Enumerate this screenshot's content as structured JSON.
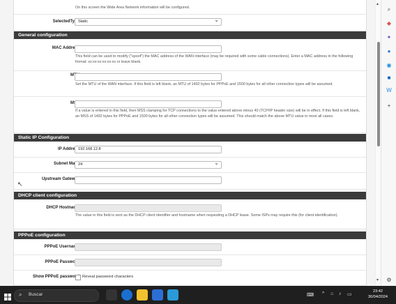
{
  "top_intro": "On this screen the Wide Area Network information will be configured.",
  "selected_type": {
    "label": "SelectedType",
    "value": "Static"
  },
  "general": {
    "header": "General configuration",
    "mac": {
      "label": "MAC Address",
      "value": "",
      "help": "This field can be used to modify (\"spoof\") the MAC address of the WAN interface (may be required with some cable connections). Enter a MAC address in the following format: xx:xx:xx:xx:xx:xx or leave blank."
    },
    "mtu": {
      "label": "MTU",
      "value": "",
      "help": "Set the MTU of the WAN interface. If this field is left blank, an MTU of 1492 bytes for PPPoE and 1500 bytes for all other connection types will be assumed."
    },
    "mss": {
      "label": "MSS",
      "value": "",
      "help": "If a value is entered in this field, then MSS clamping for TCP connections to the value entered above minus 40 (TCP/IP header size) will be in effect. If this field is left blank, an MSS of 1492 bytes for PPPoE and 1500 bytes for all other connection types will be assumed. This should match the above MTU value in most all cases."
    }
  },
  "static_ip": {
    "header": "Static IP Configuration",
    "ip": {
      "label": "IP Address",
      "value": "192.168.12.8"
    },
    "subnet": {
      "label": "Subnet Mask",
      "value": "24"
    },
    "gateway": {
      "label": "Upstream Gateway",
      "value": ""
    }
  },
  "dhcp": {
    "header": "DHCP client configuration",
    "hostname": {
      "label": "DHCP Hostname",
      "value": "",
      "help": "The value in this field is sent as the DHCP client identifier and hostname when requesting a DHCP lease. Some ISPs may require this (for client identification)."
    }
  },
  "pppoe": {
    "header": "PPPoE configuration",
    "username": {
      "label": "PPPoE Username",
      "value": ""
    },
    "password": {
      "label": "PPPoE Password",
      "value": ""
    },
    "show_password": {
      "label": "Show PPPoE password",
      "checkbox_label": "Reveal password characters"
    }
  },
  "taskbar": {
    "search_placeholder": "Buscar",
    "time": "23:42",
    "date": "30/04/2024"
  },
  "colors": {
    "section_header_bg": "#3b3b3b",
    "taskbar_bg": "#1f1f1f"
  }
}
